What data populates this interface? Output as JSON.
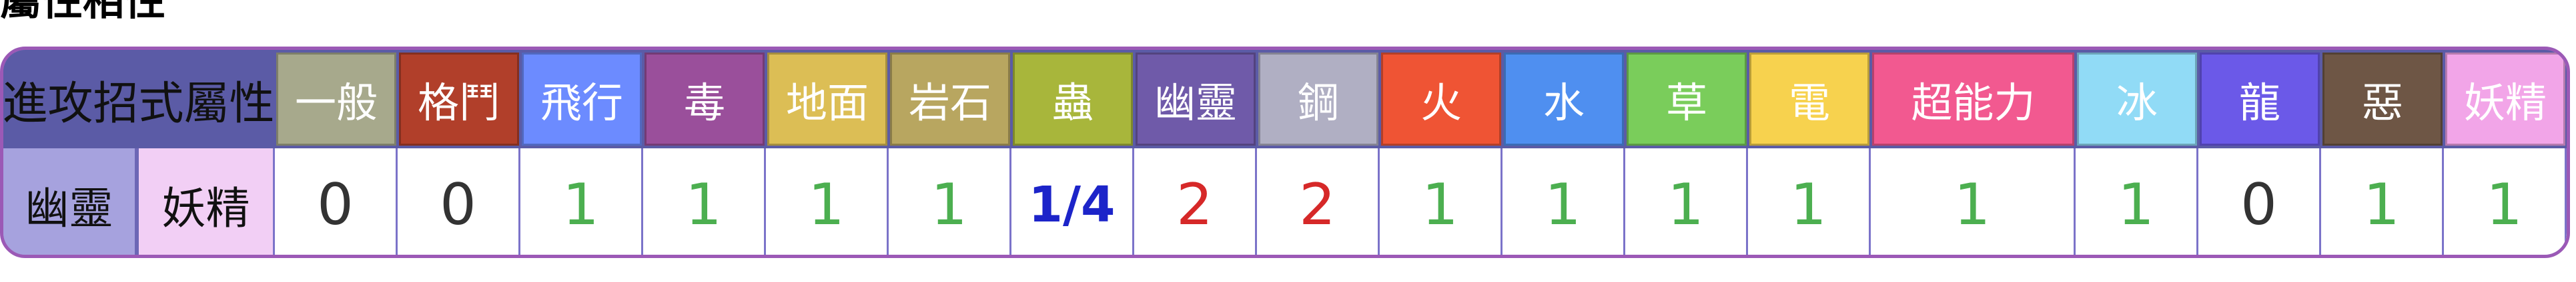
{
  "title": "屬性相性",
  "header": {
    "attack_label": "進攻招式屬性",
    "types": [
      {
        "label": "一般",
        "color": "#a7a98c"
      },
      {
        "label": "格鬥",
        "color": "#b13f2a"
      },
      {
        "label": "飛行",
        "color": "#6c8bff"
      },
      {
        "label": "毒",
        "color": "#9a4f9b"
      },
      {
        "label": "地面",
        "color": "#dcbe55"
      },
      {
        "label": "岩石",
        "color": "#b8a660"
      },
      {
        "label": "蟲",
        "color": "#a8b63b"
      },
      {
        "label": "幽靈",
        "color": "#6f5aa9"
      },
      {
        "label": "鋼",
        "color": "#b0afc3"
      },
      {
        "label": "火",
        "color": "#ef5434"
      },
      {
        "label": "水",
        "color": "#4f8ff0"
      },
      {
        "label": "草",
        "color": "#7acd5b"
      },
      {
        "label": "電",
        "color": "#f7d24e"
      },
      {
        "label": "超能力",
        "color": "#f25990"
      },
      {
        "label": "冰",
        "color": "#91dbf6"
      },
      {
        "label": "龍",
        "color": "#6b59e8"
      },
      {
        "label": "惡",
        "color": "#6e5645"
      },
      {
        "label": "妖精",
        "color": "#f2a5e8"
      }
    ]
  },
  "defender": {
    "type1": "幽靈",
    "type2": "妖精",
    "values": [
      "0",
      "0",
      "1",
      "1",
      "1",
      "1",
      "1/4",
      "2",
      "2",
      "1",
      "1",
      "1",
      "1",
      "1",
      "1",
      "0",
      "1",
      "1"
    ]
  }
}
